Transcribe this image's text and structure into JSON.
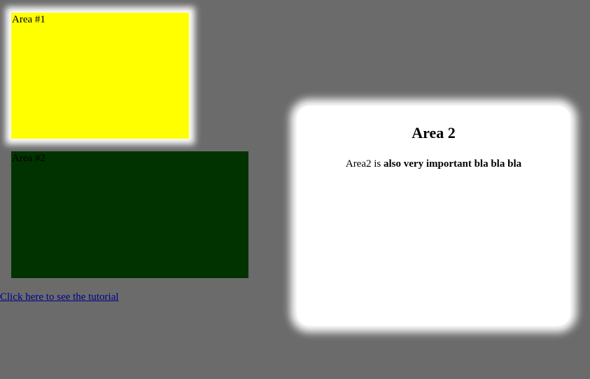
{
  "areas": [
    {
      "label": "Area #1",
      "color": "#ffff00"
    },
    {
      "label": "Area #2",
      "color": "#003300"
    }
  ],
  "link": {
    "label": "Click here to see the tutorial"
  },
  "popup": {
    "title": "Area 2",
    "text_plain": "Area2 is ",
    "text_bold": "also very important bla bla bla"
  },
  "colors": {
    "page_background": "#6b6b6b",
    "popup_background": "#ffffff",
    "link": "#00008b"
  }
}
